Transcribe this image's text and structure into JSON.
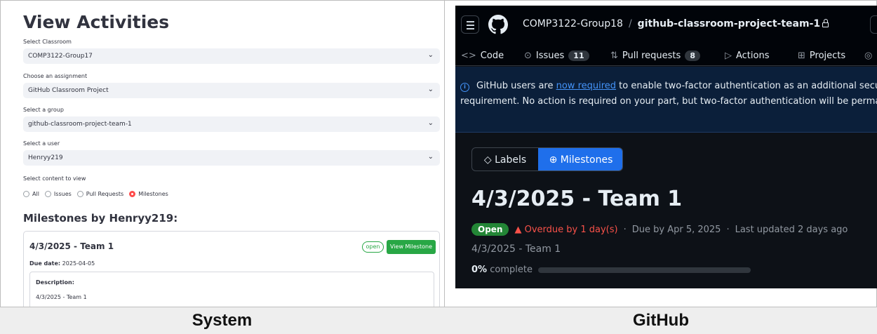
{
  "system": {
    "title": "View Activities",
    "fields": [
      {
        "label": "Select Classroom",
        "value": "COMP3122-Group17"
      },
      {
        "label": "Choose an assignment",
        "value": "GitHub Classroom Project"
      },
      {
        "label": "Select a group",
        "value": "github-classroom-project-team-1"
      },
      {
        "label": "Select a user",
        "value": "Henryy219"
      }
    ],
    "content_label": "Select content to view",
    "radio_options": [
      "All",
      "Issues",
      "Pull Requests",
      "Milestones"
    ],
    "selected_radio": "Milestones",
    "section_title": "Milestones by Henryy219:",
    "milestone": {
      "title": "4/3/2025 - Team 1",
      "status": "open",
      "button": "View Milestone",
      "due_label": "Due date:",
      "due_value": "2025-04-05",
      "description_label": "Description:",
      "description": "4/3/2025 - Team 1"
    }
  },
  "github": {
    "owner": "COMP3122-Group18",
    "separator": "/",
    "repo": "github-classroom-project-team-1",
    "tabs": [
      {
        "label": "Code",
        "icon": "code-icon"
      },
      {
        "label": "Issues",
        "icon": "issue-icon",
        "count": "11"
      },
      {
        "label": "Pull requests",
        "icon": "pull-request-icon",
        "count": "8"
      },
      {
        "label": "Actions",
        "icon": "play-icon"
      },
      {
        "label": "Projects",
        "icon": "table-icon"
      }
    ],
    "banner": {
      "pre": "GitHub users are ",
      "link": "now required",
      "post": " to enable two-factor authentication as an additional securi",
      "line2": "requirement. No action is required on your part, but two-factor authentication will be permaner"
    },
    "segments": {
      "labels": "Labels",
      "milestones": "Milestones",
      "active": "Milestones"
    },
    "milestone_title": "4/3/2025 - Team 1",
    "state": "Open",
    "overdue": "Overdue by 1 day(s)",
    "dot": "·",
    "due": "Due by Apr 5, 2025",
    "updated": "Last updated 2 days ago",
    "description": "4/3/2025 - Team 1",
    "progress_percent": "0%",
    "progress_text": "complete",
    "progress_value": 0
  },
  "captions": {
    "left": "System",
    "right": "GitHub"
  },
  "colors": {
    "accent_red": "#ff4b4b",
    "success_green": "#28a745",
    "github_blue": "#1f6feb",
    "github_bg": "#0d1117"
  }
}
